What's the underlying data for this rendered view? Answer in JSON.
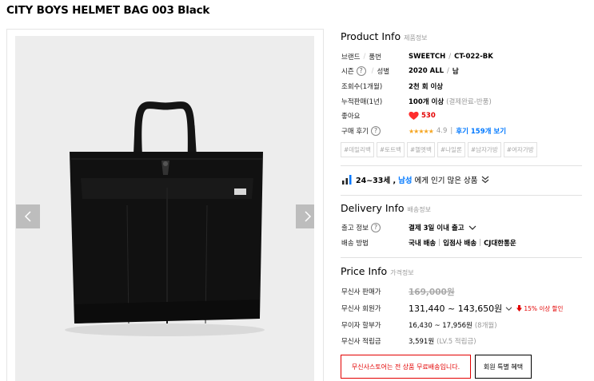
{
  "product": {
    "title": "CITY BOYS HELMET BAG 003 Black"
  },
  "product_info": {
    "heading": "Product Info",
    "subheading": "제품정보",
    "brand_label_a": "브랜드",
    "brand_label_b": "품번",
    "brand_value": "SWEETCH",
    "brand_code": "CT-022-BK",
    "season_label_a": "시즌",
    "season_label_b": "성별",
    "season_value": "2020 ALL",
    "gender_value": "남",
    "views_label": "조회수(1개월)",
    "views_value": "2천 회 이상",
    "sales_label": "누적판매(1년)",
    "sales_value": "100개 이상",
    "sales_note": "(결제완료-반품)",
    "likes_label": "좋아요",
    "likes_value": "530",
    "review_label": "구매 후기",
    "stars": "★★★★★",
    "rating": "4.9",
    "review_link": "후기 159개 보기",
    "tags": [
      "#데일리백",
      "#토트백",
      "#헬멧백",
      "#나일론",
      "#남자가방",
      "#여자가방"
    ],
    "popular_age": "24~33세 ,",
    "popular_gender": "남성",
    "popular_suffix": "에게 인기 많은 상품"
  },
  "delivery_info": {
    "heading": "Delivery Info",
    "subheading": "배송정보",
    "ship_label": "출고 정보",
    "ship_value": "결제 3일 이내 출고",
    "method_label": "배송 방법",
    "method_1": "국내 배송",
    "method_2": "입점사 배송",
    "method_3": "CJ대한통운"
  },
  "price_info": {
    "heading": "Price Info",
    "subheading": "가격정보",
    "musinsa_price_label": "무신사 판매가",
    "musinsa_price": "169,000원",
    "member_price_label": "무신사 회원가",
    "member_price": "131,440 ~ 143,650원",
    "member_discount": "15% 이상 할인",
    "installment_label": "무이자 할부가",
    "installment_value": "16,430 ~ 17,956원",
    "installment_note": "(8개월)",
    "points_label": "무신사 적립금",
    "points_value": "3,591원",
    "points_note": "(LV.5 적립금)",
    "free_shipping_button": "무신사스토어는 전 상품 무료배송입니다.",
    "member_benefit_button": "회원 특별 혜택"
  },
  "colors": {
    "accent_red": "#e30000",
    "link_blue": "#0078ff",
    "star_orange": "#f5a623",
    "heart_red": "#ff2d2d"
  },
  "icons": [
    "chevron-left-icon",
    "chevron-right-icon",
    "question-icon",
    "heart-icon",
    "star-icon",
    "bar-chart-icon",
    "double-chevron-down-icon",
    "chevron-down-icon",
    "arrow-down-icon"
  ]
}
